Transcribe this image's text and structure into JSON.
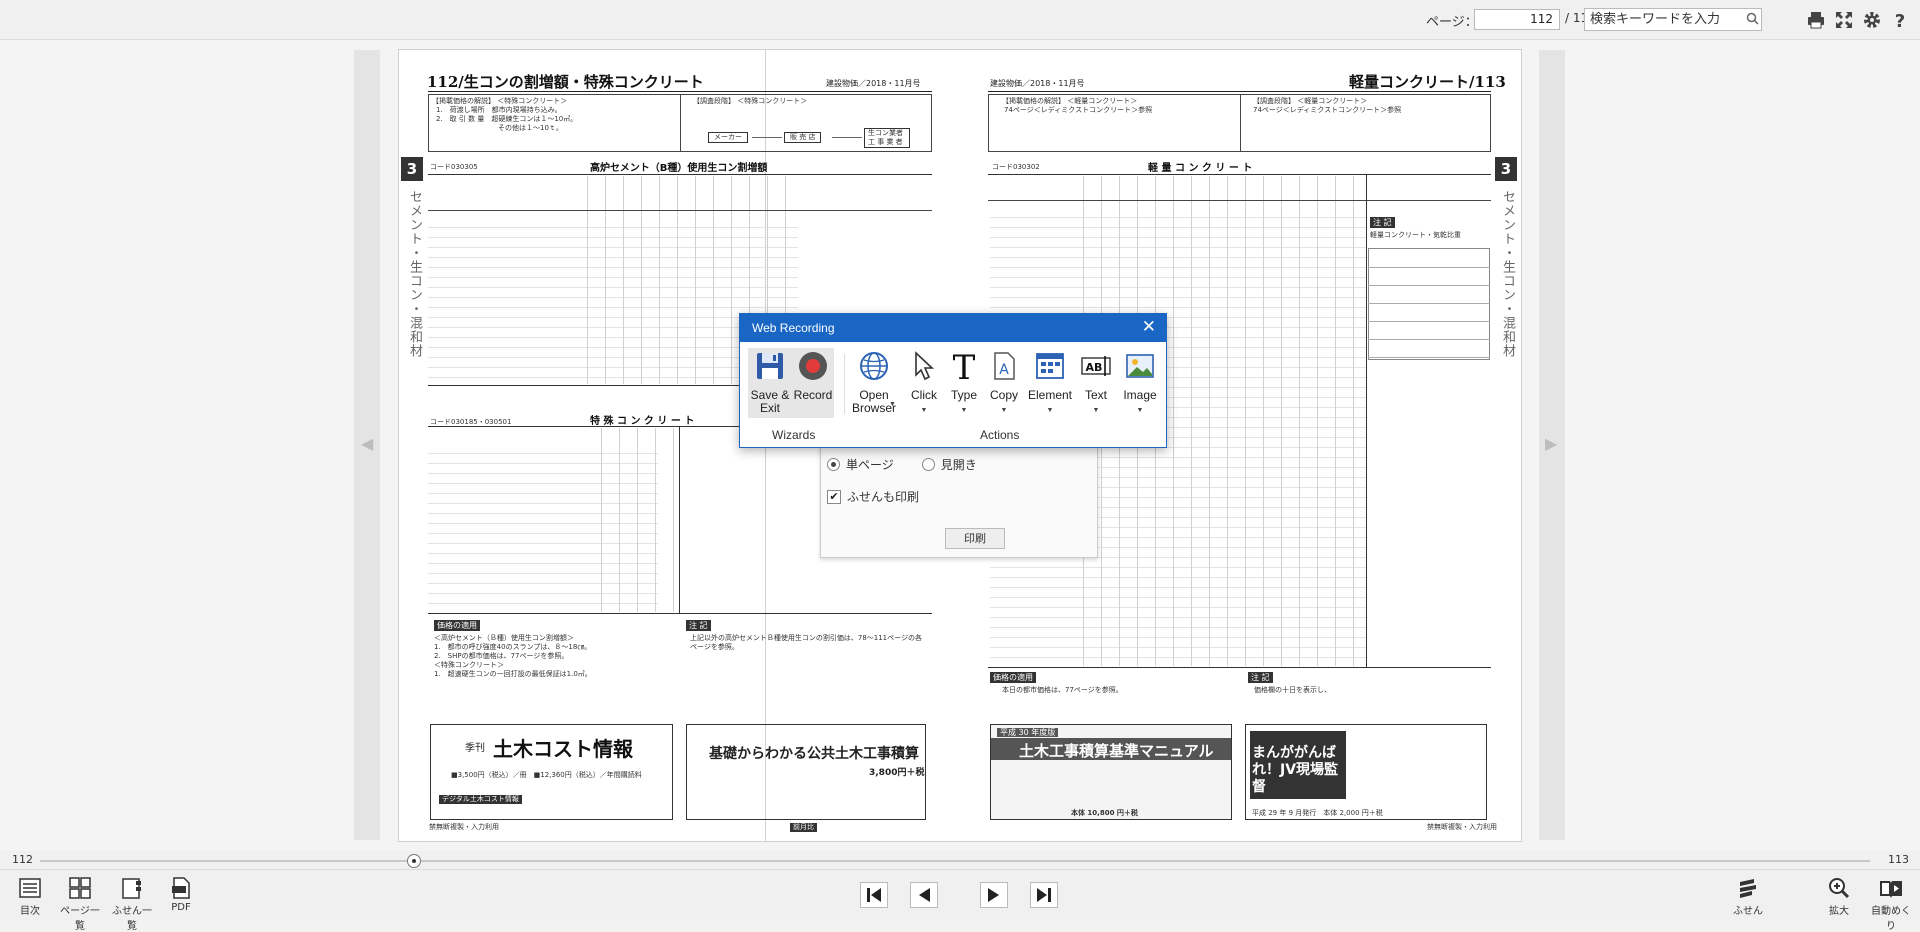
{
  "toolbar": {
    "page_label": "ページ：",
    "page_value": "112",
    "page_total": "/ 1112",
    "search_placeholder": "検索キーワードを入力",
    "icons": [
      "print-icon",
      "fullscreen-icon",
      "settings-icon",
      "help-icon"
    ]
  },
  "left_page": {
    "title": "112/生コンの割増額・特殊コンクリート",
    "date": "建設物価／2018・11月号",
    "chapter": "3",
    "side_label": "セメント・生コン・混和材",
    "box1_title": "【掲載価格の解説】 ＜特殊コンクリート＞",
    "box1_line1": "1.　荷渡し場所　都市内現場持ち込み。",
    "box1_line2": "2.　取 引 数 量　超硬練生コンは１～10㎥。",
    "box1_line3": "その他は１～10ｔ。",
    "box2_title": "【調査段階】 ＜特殊コンクリート＞",
    "flow_maker": "メーカー",
    "flow_shop": "販 売 店",
    "flow_user": "生コン業者 工 事 業 者",
    "code1": "コード030305",
    "table1_title": "高炉セメント（B種）使用生コン割増額",
    "code2": "コード030185・030501",
    "table2_title": "特 殊 コ ン ク リ ー ト",
    "price_tag": "価格の適用",
    "price_note1": "＜高炉セメント（Ｂ種）使用生コン割増額＞",
    "price_note2": "1.　都市の呼び強度40のスランプは、８～18㎝。",
    "price_note3": "2.　SHPの都市価格は、77ページを参照。",
    "price_note4": "＜特殊コンクリート＞",
    "price_note5": "1.　超速硬生コンの一回打設の最低保証は1.0㎥。",
    "note_tag": "注 記",
    "note_text": "上記以外の高炉セメントＢ種使用生コンの割引価は、78～111ページの各ページを参照。",
    "ad1_sub": "季刊",
    "ad1_title": "土木コスト情報",
    "ad1_price": "■3,500円（税込）／冊　■12,360円（税込）／年間購読料",
    "ad1_digital": "デジタル土木コスト情報",
    "ad2_title": "基礎からわかる公共土木工事積算",
    "ad2_price": "3,800円＋税",
    "footer_left": "禁無断複製・入力利用",
    "footer_badge": "前月比"
  },
  "right_page": {
    "title": "軽量コンクリート/113",
    "date": "建設物価／2018・11月号",
    "chapter": "3",
    "side_label": "セメント・生コン・混和材",
    "box1_title": "【掲載価格の解説】 ＜軽量コンクリート＞",
    "box1_line1": "74ページ＜レディミクストコンクリート＞参照",
    "box2_title": "【調査段階】 ＜軽量コンクリート＞",
    "box2_line1": "74ページ＜レディミクストコンクリート＞参照",
    "code1": "コード030302",
    "table1_title": "軽 量 コ ン ク リ ー ト",
    "note_tag": "注 記",
    "note_text": "軽量コンクリート・気乾比重",
    "price_tag": "価格の適用",
    "price_note": "本日の都市価格は、77ページを参照。",
    "note2_tag": "注 記",
    "note2_text": "価格欄の十日を表示し、",
    "ad1_sub": "平成 30 年度版",
    "ad1_title": "土木工事積算基準マニュアル",
    "ad1_price": "本体 10,800 円＋税",
    "ad2_title": "まんががんばれ！JV現場監督",
    "ad2_price": "平成 29 年 9 月発行　本体 2,000 円＋税",
    "footer_right": "禁無断複製・入力利用"
  },
  "print_panel": {
    "single_page": "単ページ",
    "spread": "見開き",
    "include_sticky": "ふせんも印刷",
    "print_button": "印刷"
  },
  "web_recording": {
    "title": "Web Recording",
    "buttons": [
      {
        "label": "Save & Exit",
        "icon": "save-icon"
      },
      {
        "label": "Record",
        "icon": "record-icon"
      },
      {
        "label": "Open Browser",
        "icon": "globe-icon"
      },
      {
        "label": "Click",
        "icon": "cursor-icon"
      },
      {
        "label": "Type",
        "icon": "type-icon"
      },
      {
        "label": "Copy",
        "icon": "copy-icon"
      },
      {
        "label": "Element",
        "icon": "element-icon"
      },
      {
        "label": "Text",
        "icon": "text-icon"
      },
      {
        "label": "Image",
        "icon": "image-icon"
      }
    ],
    "group_wizards": "Wizards",
    "group_actions": "Actions"
  },
  "slider": {
    "left_label": "112",
    "right_label": "113"
  },
  "bottom_bar": {
    "toc": "目次",
    "page_list": "ページ一覧",
    "sticky_list": "ふせん一覧",
    "pdf": "PDF",
    "sticky": "ふせん",
    "zoom": "拡大",
    "auto_flip": "自動めくり"
  }
}
